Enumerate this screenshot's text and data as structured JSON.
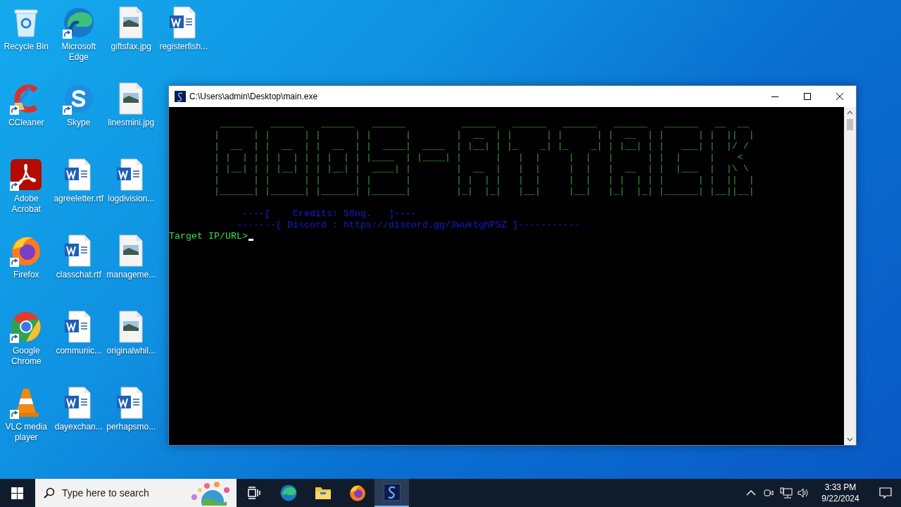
{
  "desktop_icons": [
    {
      "label": "Recycle Bin",
      "kind": "recycle",
      "shortcut": false
    },
    {
      "label": "CCleaner",
      "kind": "ccleaner",
      "shortcut": true
    },
    {
      "label": "Adobe Acrobat",
      "kind": "acrobat",
      "shortcut": true
    },
    {
      "label": "Firefox",
      "kind": "firefox",
      "shortcut": true
    },
    {
      "label": "Google Chrome",
      "kind": "chrome",
      "shortcut": true
    },
    {
      "label": "VLC media player",
      "kind": "vlc",
      "shortcut": true
    },
    {
      "label": "Microsoft Edge",
      "kind": "edge",
      "shortcut": true
    },
    {
      "label": "Skype",
      "kind": "skype",
      "shortcut": true
    },
    {
      "label": "agreeletter.rtf",
      "kind": "word",
      "shortcut": false
    },
    {
      "label": "classchat.rtf",
      "kind": "word",
      "shortcut": false
    },
    {
      "label": "communic...",
      "kind": "word",
      "shortcut": false
    },
    {
      "label": "dayexchan...",
      "kind": "word",
      "shortcut": false
    },
    {
      "label": "giftsfax.jpg",
      "kind": "image",
      "shortcut": false
    },
    {
      "label": "linesmini.jpg",
      "kind": "image",
      "shortcut": false
    },
    {
      "label": "logdivision...",
      "kind": "word",
      "shortcut": false
    },
    {
      "label": "manageme...",
      "kind": "image",
      "shortcut": false
    },
    {
      "label": "originalwhil...",
      "kind": "image",
      "shortcut": false
    },
    {
      "label": "perhapsmo...",
      "kind": "word",
      "shortcut": false
    },
    {
      "label": "registerfish...",
      "kind": "word",
      "shortcut": false
    }
  ],
  "console_window": {
    "title": "C:\\Users\\admin\\Desktop\\main.exe",
    "banner": [
      "         ______   ______   ______   ______          ______   ______   ______   ______   ______   __  __",
      "        |      | |      | |      | |      |        |  __  | |      | |      | |  __  | |      | |  ||  |",
      "        |  __  | |  __  | |  __  | |  ____|  ____  | |__| | |_    _| |_    _| | |__| | |   ___| |  |/ /",
      "        | |  | | | |  | | | |  | | |____  | |____| |      |   |  |     |  |   |      | |  |     |    <",
      "        | |__| | | |__| | | |__| |  ____| |        |  __  |   |  |     |  |   |  __  | |  |___  |  |\\ \\",
      "        |      | |      | |      | |      |        | |  | |   |  |     |  |   | |  | | |      | |  ||  |",
      "        |______| |______| |______| |______|        |_|  |_|   |__|     |__|   |_|  |_| |______| |__||__|"
    ],
    "info_lines": [
      "             ----[    Credits: S0ng.   ]----",
      "            -------[ Discord : https://discord.gg/3wuktghPSZ ]-----------"
    ],
    "prompt": "Target IP/URL>"
  },
  "taskbar": {
    "search_placeholder": "Type here to search",
    "apps": [
      {
        "kind": "taskview",
        "active": false
      },
      {
        "kind": "edge",
        "active": false
      },
      {
        "kind": "explorer",
        "active": false
      },
      {
        "kind": "firefox",
        "active": false
      },
      {
        "kind": "console",
        "active": true
      }
    ],
    "time": "3:33 PM",
    "date": "9/22/2024"
  }
}
